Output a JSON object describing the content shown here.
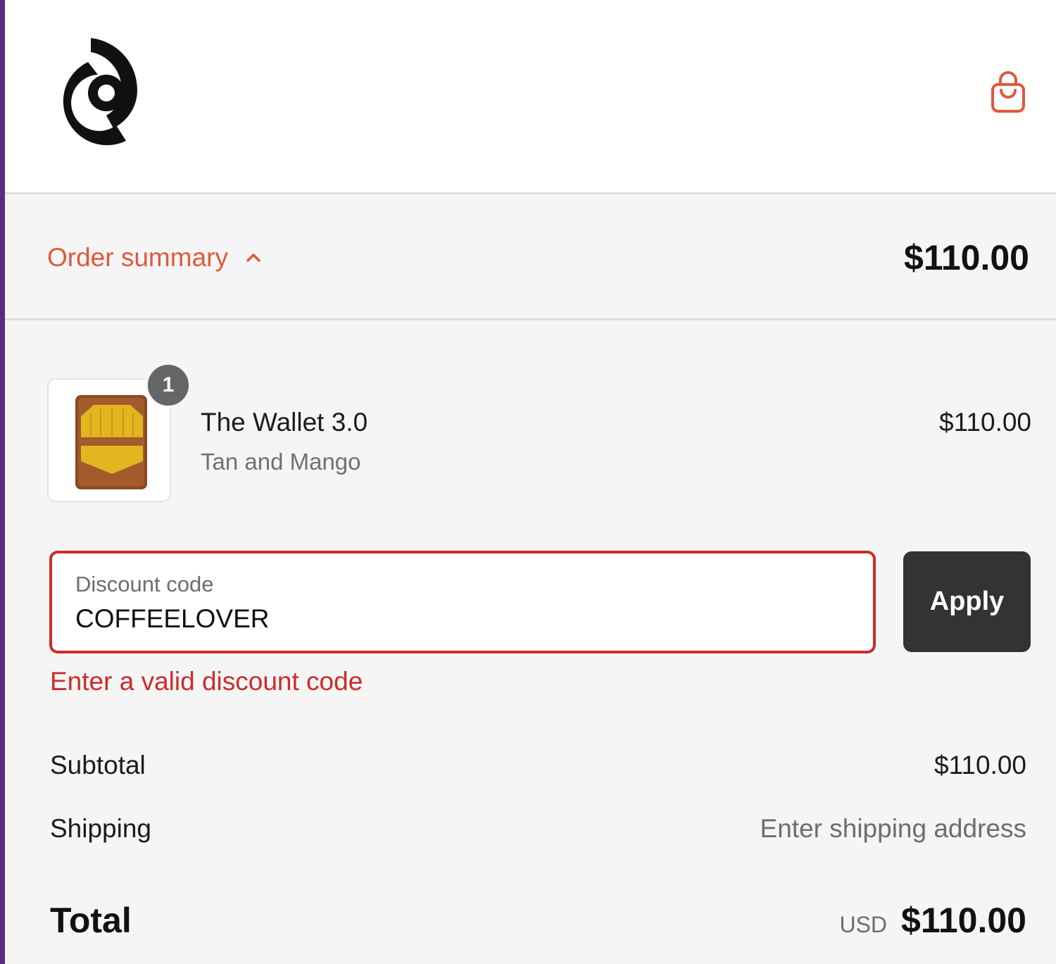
{
  "brand": {
    "accent_color": "#e0593b",
    "error_color": "#cc2b2b",
    "logo_icon": "brand-logo-icon",
    "cart_icon": "shopping-bag-icon"
  },
  "summary": {
    "toggle_label": "Order summary",
    "toggle_icon": "chevron-up-icon",
    "total": "$110.00"
  },
  "line_items": [
    {
      "quantity": "1",
      "name": "The Wallet 3.0",
      "variant": "Tan and Mango",
      "price": "$110.00"
    }
  ],
  "discount": {
    "label": "Discount code",
    "value": "COFFEELOVER",
    "apply_label": "Apply",
    "error": "Enter a valid discount code"
  },
  "totals": {
    "subtotal_label": "Subtotal",
    "subtotal_value": "$110.00",
    "shipping_label": "Shipping",
    "shipping_value": "Enter shipping address",
    "total_label": "Total",
    "currency": "USD",
    "total_value": "$110.00"
  }
}
